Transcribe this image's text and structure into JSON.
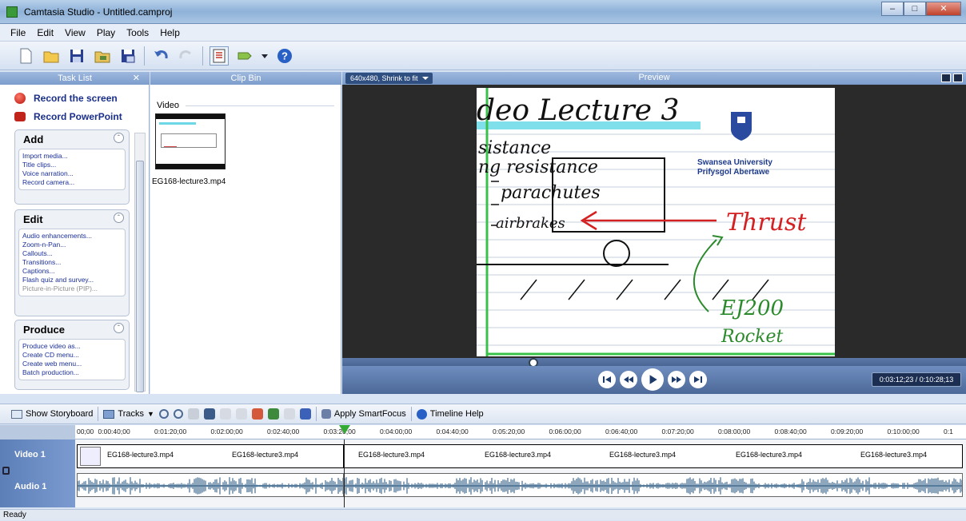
{
  "window": {
    "title": "Camtasia Studio - Untitled.camproj"
  },
  "menu": [
    "File",
    "Edit",
    "View",
    "Play",
    "Tools",
    "Help"
  ],
  "toolbar": {
    "icons": [
      "new-project-icon",
      "open-folder-icon",
      "save-icon",
      "import-icon",
      "save-as-icon",
      "undo-icon",
      "redo-icon",
      "task-list-icon",
      "produce-icon",
      "help-icon"
    ]
  },
  "tasklist": {
    "header": "Task List",
    "record_screen": "Record the screen",
    "record_ppt": "Record PowerPoint",
    "add": {
      "title": "Add",
      "items": [
        "Import media...",
        "Title clips...",
        "Voice narration...",
        "Record camera..."
      ]
    },
    "edit": {
      "title": "Edit",
      "items": [
        "Audio enhancements...",
        "Zoom-n-Pan...",
        "Callouts...",
        "Transitions...",
        "Captions...",
        "Flash quiz and survey...",
        "Picture-in-Picture (PIP)..."
      ]
    },
    "produce": {
      "title": "Produce",
      "items": [
        "Produce video as...",
        "Create CD menu...",
        "Create web menu...",
        "Batch production..."
      ]
    }
  },
  "clipbin": {
    "header": "Clip Bin",
    "section": "Video",
    "clip_name": "EG168-lecture3.mp4"
  },
  "preview": {
    "header": "Preview",
    "size_mode": "640x480, Shrink to fit",
    "time": "0:03:12;23 / 0:10:28;13",
    "seek_progress": 0.306,
    "slide": {
      "title": "deo Lecture 3",
      "lines": [
        "sistance",
        "ng resistance",
        "parachutes",
        "airbrakes",
        "Thrust",
        "EJ200",
        "Rocket"
      ],
      "logo_line1": "Swansea University",
      "logo_line2": "Prifysgol Abertawe"
    }
  },
  "timeline": {
    "show_storyboard": "Show Storyboard",
    "tracks_label": "Tracks",
    "smartfocus": "Apply SmartFocus",
    "help": "Timeline Help",
    "ticks": [
      "00;00",
      "0:00:40;00",
      "0:01:20;00",
      "0:02:00;00",
      "0:02:40;00",
      "0:03:20;00",
      "0:04:00;00",
      "0:04:40;00",
      "0:05:20;00",
      "0:06:00;00",
      "0:06:40;00",
      "0:07:20;00",
      "0:08:00;00",
      "0:08:40;00",
      "0:09:20;00",
      "0:10:00;00",
      "0:1"
    ],
    "video_track": "Video 1",
    "audio_track": "Audio 1",
    "clip_labels": [
      "EG168-lecture3.mp4",
      "EG168-lecture3.mp4",
      "EG168-lecture3.mp4",
      "EG168-lecture3.mp4",
      "EG168-lecture3.mp4",
      "EG168-lecture3.mp4",
      "EG168-lecture3.mp4"
    ]
  },
  "status": "Ready"
}
